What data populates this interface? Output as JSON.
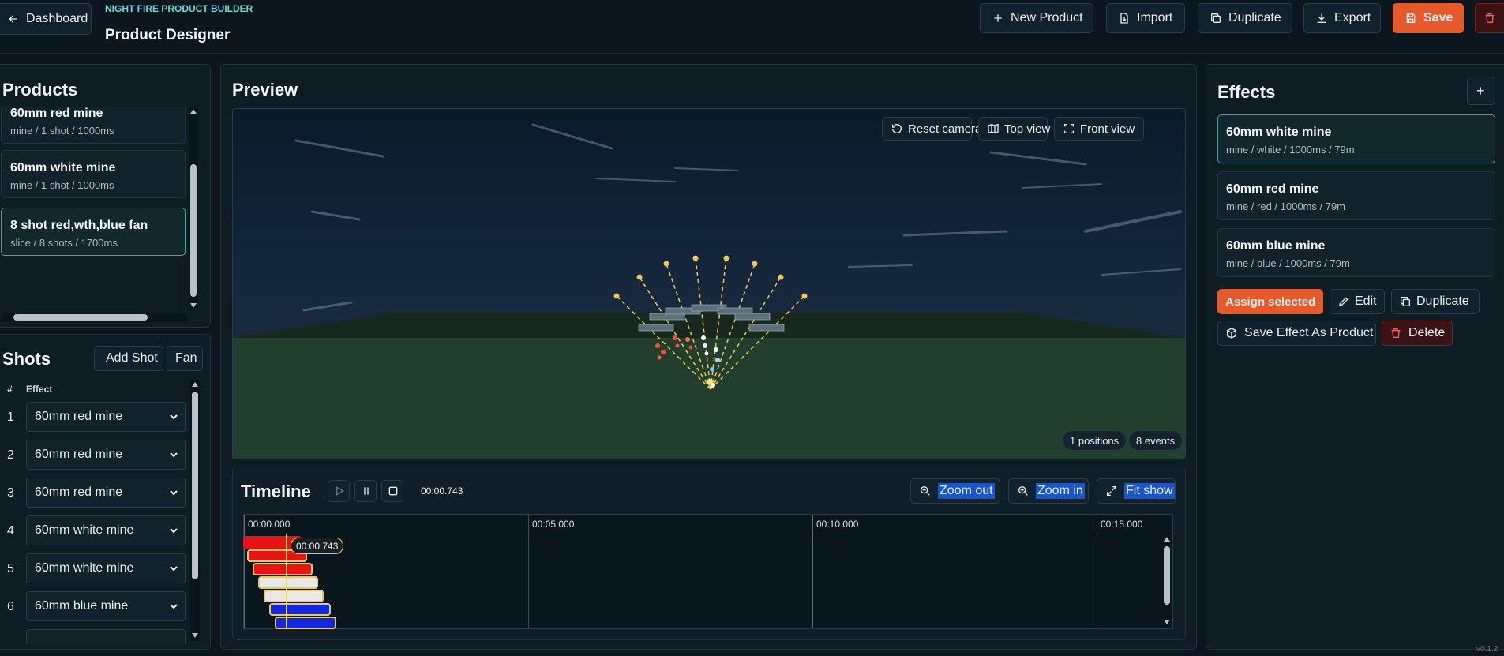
{
  "header": {
    "back_label": "Dashboard",
    "app_name": "NIGHT FIRE PRODUCT BUILDER",
    "page_title": "Product Designer",
    "actions": {
      "new_product": "New Product",
      "import": "Import",
      "duplicate": "Duplicate",
      "export": "Export",
      "save": "Save"
    }
  },
  "products": {
    "title": "Products",
    "items": [
      {
        "name": "60mm red mine",
        "meta": "mine / 1 shot / 1000ms"
      },
      {
        "name": "60mm white mine",
        "meta": "mine / 1 shot / 1000ms"
      },
      {
        "name": "8 shot red,wth,blue fan",
        "meta": "slice / 8 shots / 1700ms",
        "selected": true
      }
    ]
  },
  "shots": {
    "title": "Shots",
    "add_label": "Add Shot",
    "fan_label": "Fan",
    "col_num": "#",
    "col_effect": "Effect",
    "rows": [
      {
        "num": "1",
        "effect": "60mm red mine"
      },
      {
        "num": "2",
        "effect": "60mm red mine"
      },
      {
        "num": "3",
        "effect": "60mm red mine"
      },
      {
        "num": "4",
        "effect": "60mm white mine"
      },
      {
        "num": "5",
        "effect": "60mm white mine"
      },
      {
        "num": "6",
        "effect": "60mm blue mine"
      }
    ]
  },
  "preview": {
    "title": "Preview",
    "reset_camera": "Reset camera",
    "top_view": "Top view",
    "front_view": "Front view",
    "positions": "1 positions",
    "events": "8 events"
  },
  "timeline": {
    "title": "Timeline",
    "current_time": "00:00.743",
    "playhead_label": "00:00.743",
    "zoom_out": "Zoom out",
    "zoom_in": "Zoom in",
    "fit_show": "Fit show",
    "ticks": [
      "00:00.000",
      "00:05.000",
      "00:10.000",
      "00:15.000"
    ],
    "playhead_seconds": 0.743
  },
  "effects": {
    "title": "Effects",
    "add_label": "+",
    "items": [
      {
        "name": "60mm white mine",
        "meta": "mine / white / 1000ms / 79m",
        "selected": true
      },
      {
        "name": "60mm red mine",
        "meta": "mine / red / 1000ms / 79m"
      },
      {
        "name": "60mm blue mine",
        "meta": "mine / blue / 1000ms / 79m"
      }
    ],
    "assign_selected": "Assign selected",
    "edit": "Edit",
    "duplicate": "Duplicate",
    "save_as_product": "Save Effect As Product",
    "delete": "Delete"
  },
  "version": "v0.1.2",
  "colors": {
    "accent": "#e5592b",
    "teal": "#6fd8d2",
    "bg": "#0b161e",
    "red_shot": "#e81414",
    "white_shot": "#e8e8e8",
    "blue_shot": "#1228e0"
  }
}
